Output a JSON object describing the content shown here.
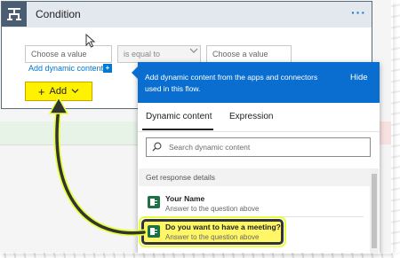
{
  "condition": {
    "title": "Condition",
    "more_label": "···",
    "choose_value_left_placeholder": "Choose a value",
    "operator_value": "is equal to",
    "choose_value_right_placeholder": "Choose a value",
    "add_dynamic_content_label": "Add dynamic content",
    "add_button_label": "Add"
  },
  "dynamic_panel": {
    "message": "Add dynamic content from the apps and connectors used in this flow.",
    "hide_label": "Hide",
    "tabs": [
      {
        "label": "Dynamic content",
        "selected": true
      },
      {
        "label": "Expression",
        "selected": false
      }
    ],
    "search_placeholder": "Search dynamic content",
    "section_title": "Get response details",
    "items": [
      {
        "title": "Your Name",
        "subtitle": "Answer to the question above"
      },
      {
        "title": "Do you want to have a meeting?",
        "subtitle": "Answer to the question above",
        "highlighted": true
      }
    ]
  },
  "colors": {
    "accent": "#0a6ed1",
    "add_button": "#fff200",
    "forms_icon": "#1e7145",
    "header_icon": "#4a5d72"
  },
  "icons": [
    "condition-icon",
    "more-icon",
    "chevron-down-icon",
    "plus-icon",
    "search-icon",
    "forms-icon",
    "cursor-icon",
    "info-icon"
  ]
}
